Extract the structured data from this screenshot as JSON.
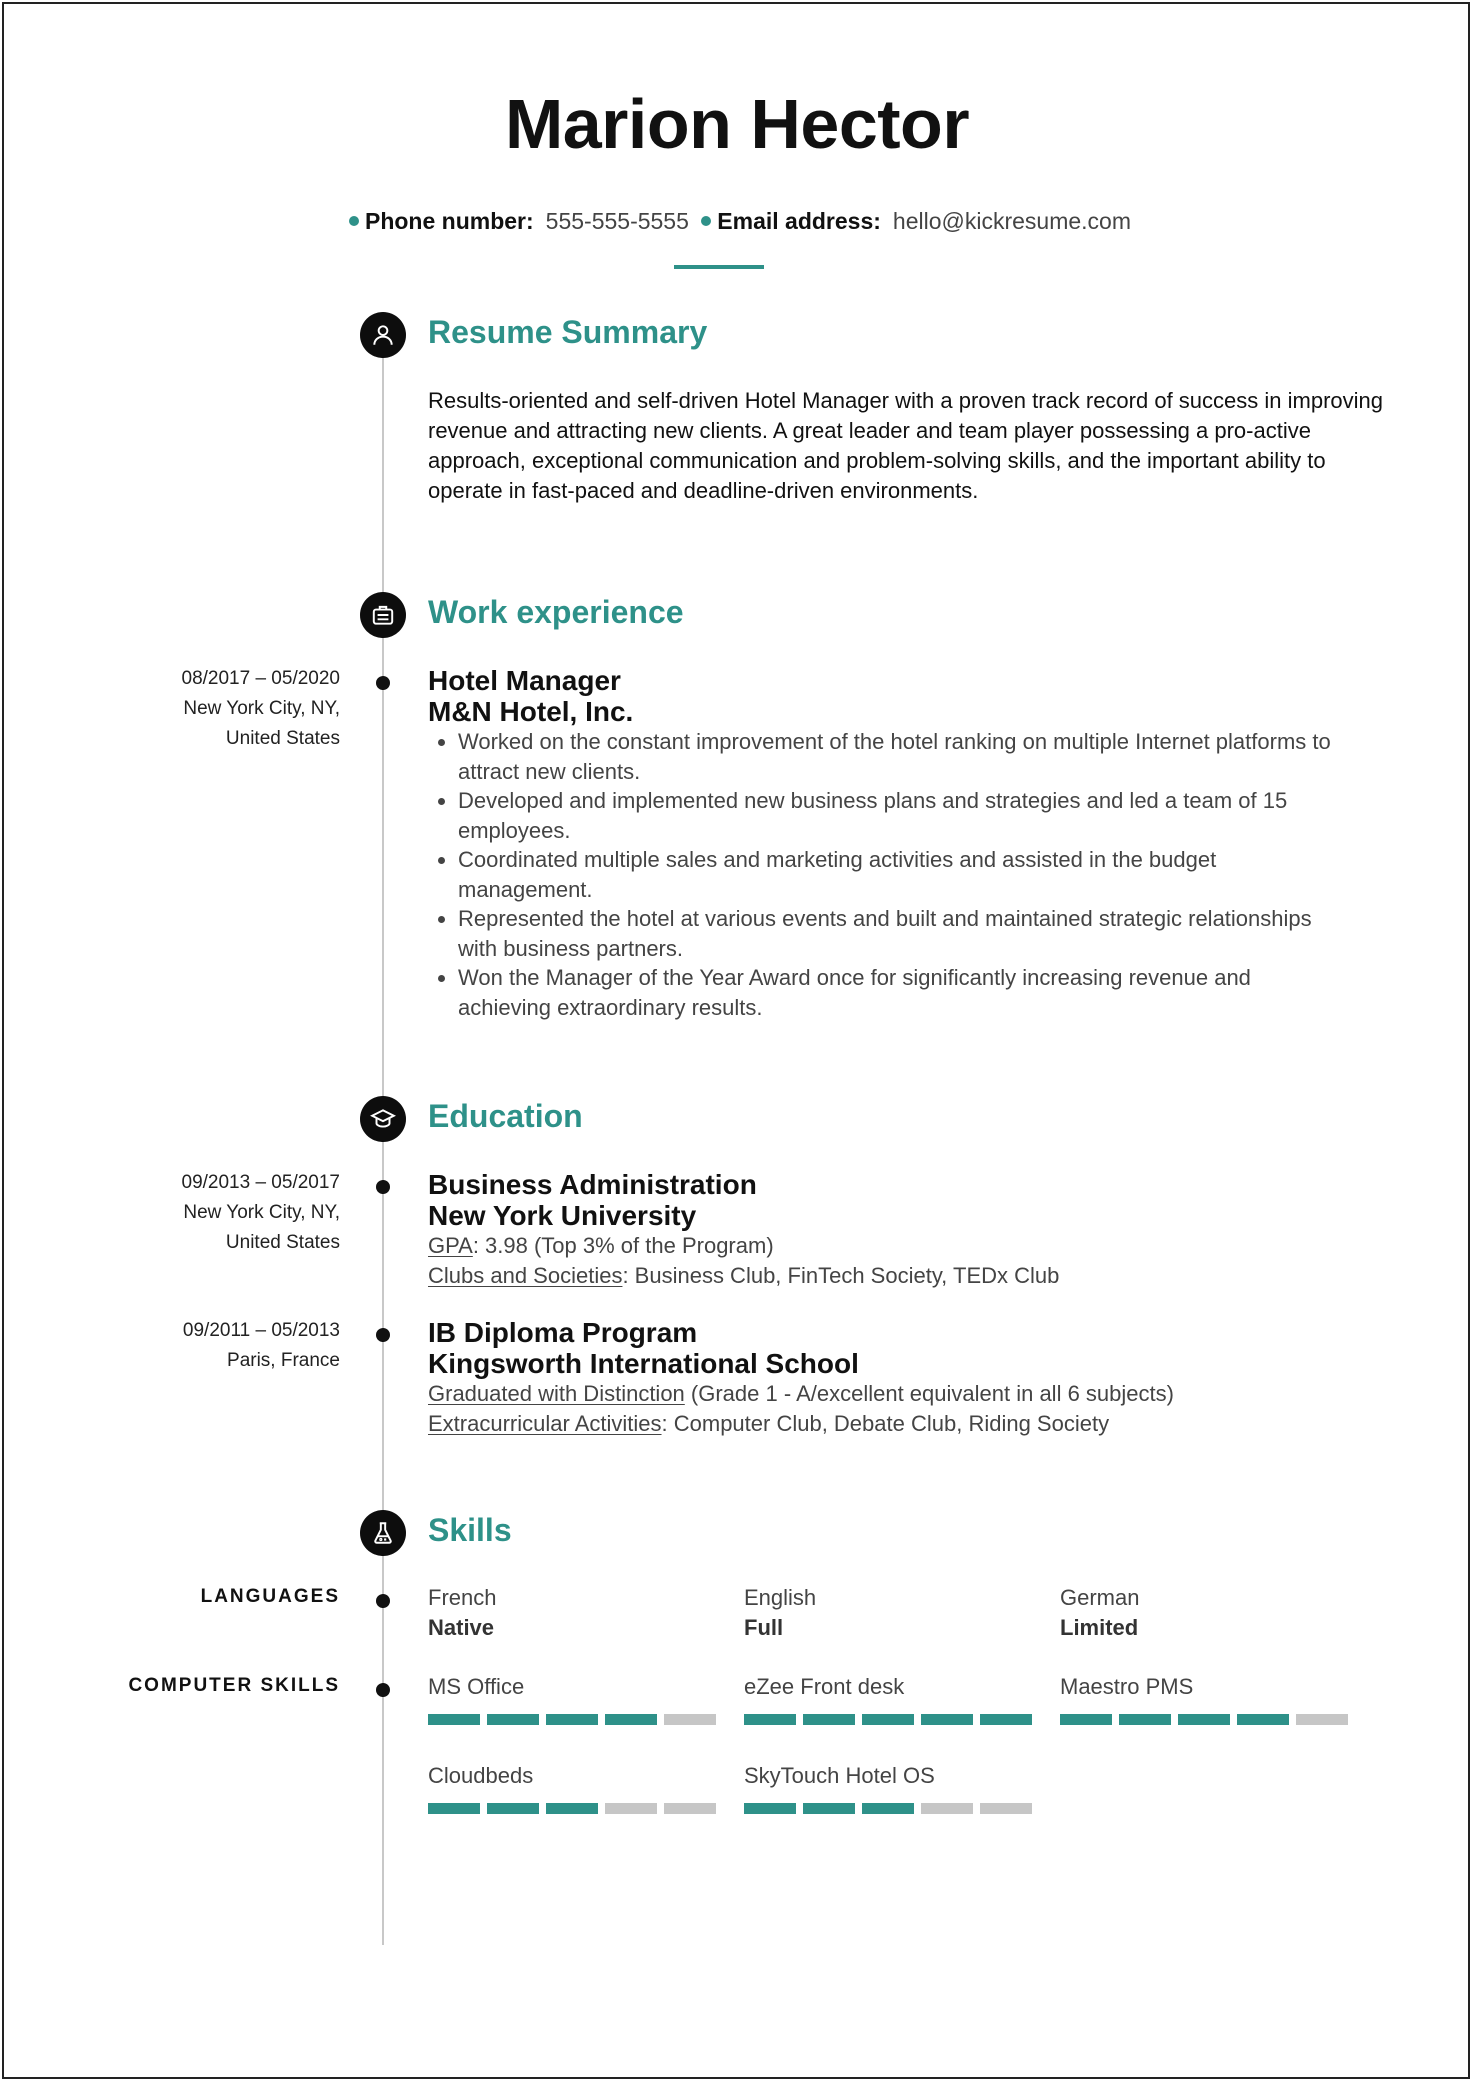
{
  "header": {
    "name": "Marion Hector",
    "phone_label": "Phone number:",
    "phone": "555-555-5555",
    "email_label": "Email address:",
    "email": "hello@kickresume.com"
  },
  "colors": {
    "accent": "#2e9189",
    "bar_empty": "#c6c6c6",
    "icon_bg": "#0d0d0d"
  },
  "summary": {
    "title": "Resume Summary",
    "icon": "person-icon",
    "text": "Results-oriented and self-driven Hotel Manager with a proven track record of success in improving revenue and attracting new clients. A great leader and team player possessing a pro-active approach, exceptional communication and problem-solving skills, and the important ability to operate in fast-paced and deadline-driven environments."
  },
  "work": {
    "title": "Work experience",
    "icon": "briefcase-icon",
    "items": [
      {
        "dates": "08/2017 – 05/2020",
        "location_line1": "New York City, NY,",
        "location_line2": "United States",
        "position": "Hotel Manager",
        "company": "M&N Hotel, Inc.",
        "bullets": [
          "Worked on the constant improvement of the hotel ranking on multiple Internet platforms to attract new clients.",
          "Developed and implemented new business plans and strategies and led a team of 15 employees.",
          "Coordinated multiple sales and marketing activities and assisted in the budget management.",
          "Represented the hotel at various events and built and maintained strategic relationships with business partners.",
          "Won the Manager of the Year Award once for significantly increasing revenue and achieving extraordinary results."
        ]
      }
    ]
  },
  "education": {
    "title": "Education",
    "icon": "graduation-cap-icon",
    "items": [
      {
        "dates": "09/2013 – 05/2017",
        "location_line1": "New York City, NY,",
        "location_line2": "United States",
        "degree": "Business Administration",
        "school": "New York University",
        "line1_label": "GPA",
        "line1_text": ": 3.98 (Top 3% of the Program)",
        "line2_label": "Clubs and Societies",
        "line2_text": ": Business Club, FinTech Society, TEDx Club"
      },
      {
        "dates": "09/2011 – 05/2013",
        "location_line1": "Paris, France",
        "location_line2": "",
        "degree": "IB Diploma Program",
        "school": "Kingsworth International School",
        "line1_label": "Graduated with Distinction",
        "line1_text": " (Grade 1 - A/excellent equivalent in all 6 subjects)",
        "line2_label": "Extracurricular Activities",
        "line2_text": ": Computer Club, Debate Club, Riding Society"
      }
    ]
  },
  "skills": {
    "title": "Skills",
    "icon": "flask-icon",
    "languages_label": "LANGUAGES",
    "languages": [
      {
        "name": "French",
        "level": "Native"
      },
      {
        "name": "English",
        "level": "Full"
      },
      {
        "name": "German",
        "level": "Limited"
      }
    ],
    "computer_label": "COMPUTER SKILLS",
    "computer": [
      {
        "name": "MS Office",
        "rating": 4,
        "max": 5
      },
      {
        "name": "eZee Front desk",
        "rating": 5,
        "max": 5
      },
      {
        "name": "Maestro PMS",
        "rating": 4,
        "max": 5
      },
      {
        "name": "Cloudbeds",
        "rating": 3,
        "max": 5
      },
      {
        "name": "SkyTouch Hotel OS",
        "rating": 3,
        "max": 5
      }
    ]
  }
}
